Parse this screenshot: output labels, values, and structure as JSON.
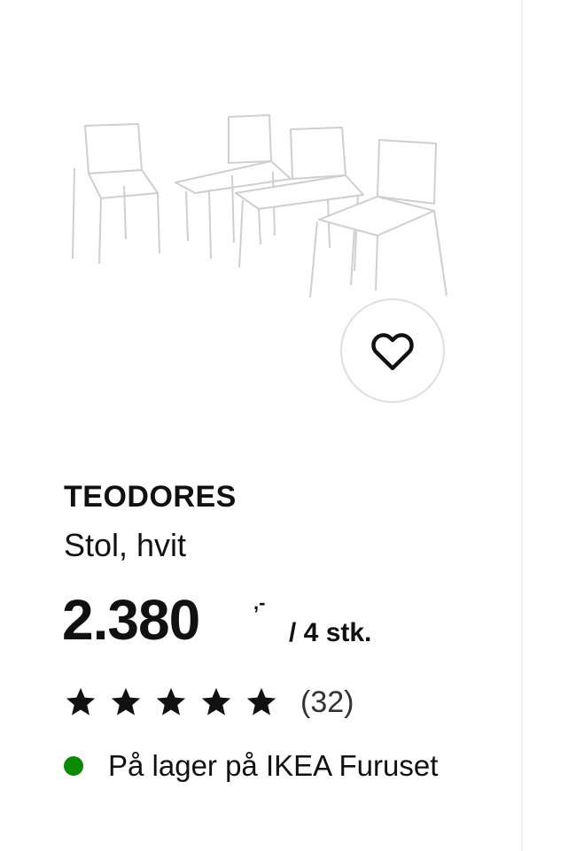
{
  "product": {
    "name": "TEODORES",
    "description": "Stol, hvit",
    "price_integer": "2.380",
    "price_decimal": ",-",
    "price_unit": "/ 4 stk.",
    "image_icon": "chairs-product-image"
  },
  "favourite": {
    "icon": "heart-outline-icon"
  },
  "rating": {
    "stars": 5,
    "max": 5,
    "count_label": "(32)"
  },
  "stock": {
    "text": "På lager på IKEA Furuset",
    "status_color": "#0a8a00"
  }
}
